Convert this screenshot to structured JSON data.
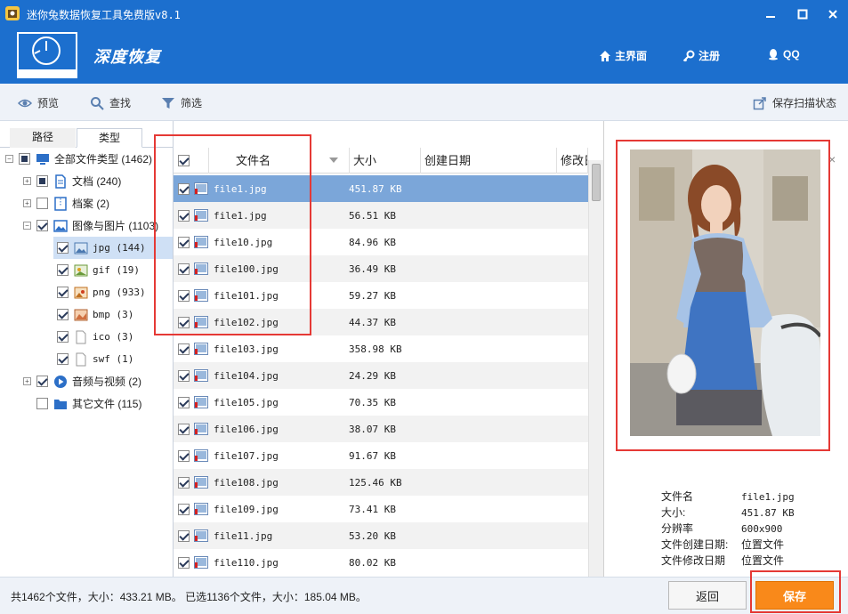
{
  "window": {
    "title": "迷你兔数据恢复工具免费版v8.1"
  },
  "header": {
    "mode_title": "深度恢复",
    "home_label": "主界面",
    "register_label": "注册",
    "qq_label": "QQ"
  },
  "toolbar": {
    "preview_label": "预览",
    "search_label": "查找",
    "filter_label": "筛选",
    "save_scan_label": "保存扫描状态"
  },
  "left_tabs": {
    "path_label": "路径",
    "type_label": "类型"
  },
  "tree": {
    "all": "全部文件类型  (1462)",
    "docs": "文档  (240)",
    "archives": "档案  (2)",
    "images": "图像与图片  (1103)",
    "jpg": "jpg  (144)",
    "gif": "gif  (19)",
    "png": "png  (933)",
    "bmp": "bmp  (3)",
    "ico": "ico  (3)",
    "swf": "swf  (1)",
    "audio_video": "音频与视频  (2)",
    "other": "其它文件  (115)"
  },
  "list": {
    "columns": {
      "name": "文件名",
      "size": "大小",
      "created": "创建日期",
      "modified": "修改日"
    },
    "rows": [
      {
        "name": "file1.jpg",
        "size": "451.87 KB"
      },
      {
        "name": "file1.jpg",
        "size": "56.51 KB"
      },
      {
        "name": "file10.jpg",
        "size": "84.96 KB"
      },
      {
        "name": "file100.jpg",
        "size": "36.49 KB"
      },
      {
        "name": "file101.jpg",
        "size": "59.27 KB"
      },
      {
        "name": "file102.jpg",
        "size": "44.37 KB"
      },
      {
        "name": "file103.jpg",
        "size": "358.98 KB"
      },
      {
        "name": "file104.jpg",
        "size": "24.29 KB"
      },
      {
        "name": "file105.jpg",
        "size": "70.35 KB"
      },
      {
        "name": "file106.jpg",
        "size": "38.07 KB"
      },
      {
        "name": "file107.jpg",
        "size": "91.67 KB"
      },
      {
        "name": "file108.jpg",
        "size": "125.46 KB"
      },
      {
        "name": "file109.jpg",
        "size": "73.41 KB"
      },
      {
        "name": "file11.jpg",
        "size": "53.20 KB"
      },
      {
        "name": "file110.jpg",
        "size": "80.02 KB"
      }
    ]
  },
  "preview": {
    "close_glyph": "×",
    "info": {
      "name_key": "文件名",
      "name_val": "file1.jpg",
      "size_key": "大小:",
      "size_val": "451.87 KB",
      "res_key": "分辨率",
      "res_val": "600x900",
      "created_key": "文件创建日期:",
      "created_val": "位置文件",
      "modified_key": "文件修改日期",
      "modified_val": "位置文件"
    }
  },
  "status": {
    "text": "共1462个文件，大小：433.21 MB。 已选1136个文件，大小：185.04 MB。",
    "back_label": "返回",
    "save_label": "保存"
  },
  "colors": {
    "brand_blue": "#1c6fce",
    "save_orange": "#f9891a",
    "selection_blue": "#7ba6d9",
    "annotation_red": "#e53935"
  }
}
